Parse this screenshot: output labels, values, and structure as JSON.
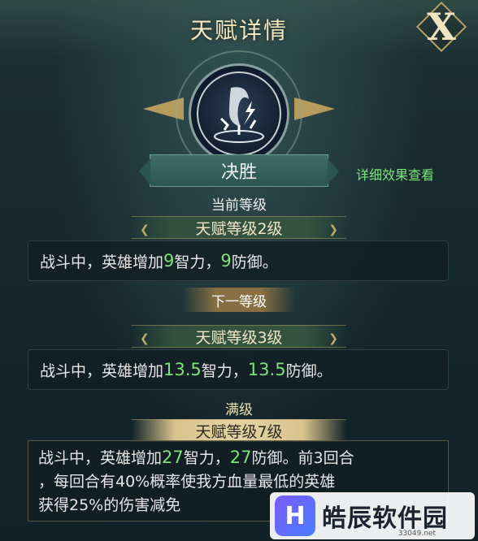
{
  "header": {
    "title": "天赋详情",
    "close_label": "X"
  },
  "talent": {
    "name": "决胜",
    "icon": "lightning-shield-icon"
  },
  "detail_link": "详细效果查看",
  "current": {
    "label": "当前等级",
    "level": "天赋等级2级",
    "desc": {
      "p1": "战斗中，英雄增加",
      "v1": "9",
      "p2": "智力，",
      "v2": "9",
      "p3": "防御。"
    }
  },
  "next": {
    "label": "下一等级",
    "level": "天赋等级3级",
    "desc": {
      "p1": "战斗中，英雄增加",
      "v1": "13.5",
      "p2": "智力，",
      "v2": "13.5",
      "p3": "防御。"
    }
  },
  "max": {
    "label": "满级",
    "level": "天赋等级7级",
    "desc": {
      "p1": "战斗中，英雄增加",
      "v1": "27",
      "p2": "智力，",
      "v2": "27",
      "p3": "防御。前3回合",
      "line2": "，每回合有40%概率使我方血量最低的英雄",
      "line3": "获得25%的伤害减免"
    }
  },
  "watermark": {
    "text": "皓辰软件园",
    "url": "33049.net",
    "logo": "H"
  },
  "colors": {
    "highlight": "#7ee27a",
    "gold": "#d9c38c",
    "banner": "#2b5550"
  }
}
